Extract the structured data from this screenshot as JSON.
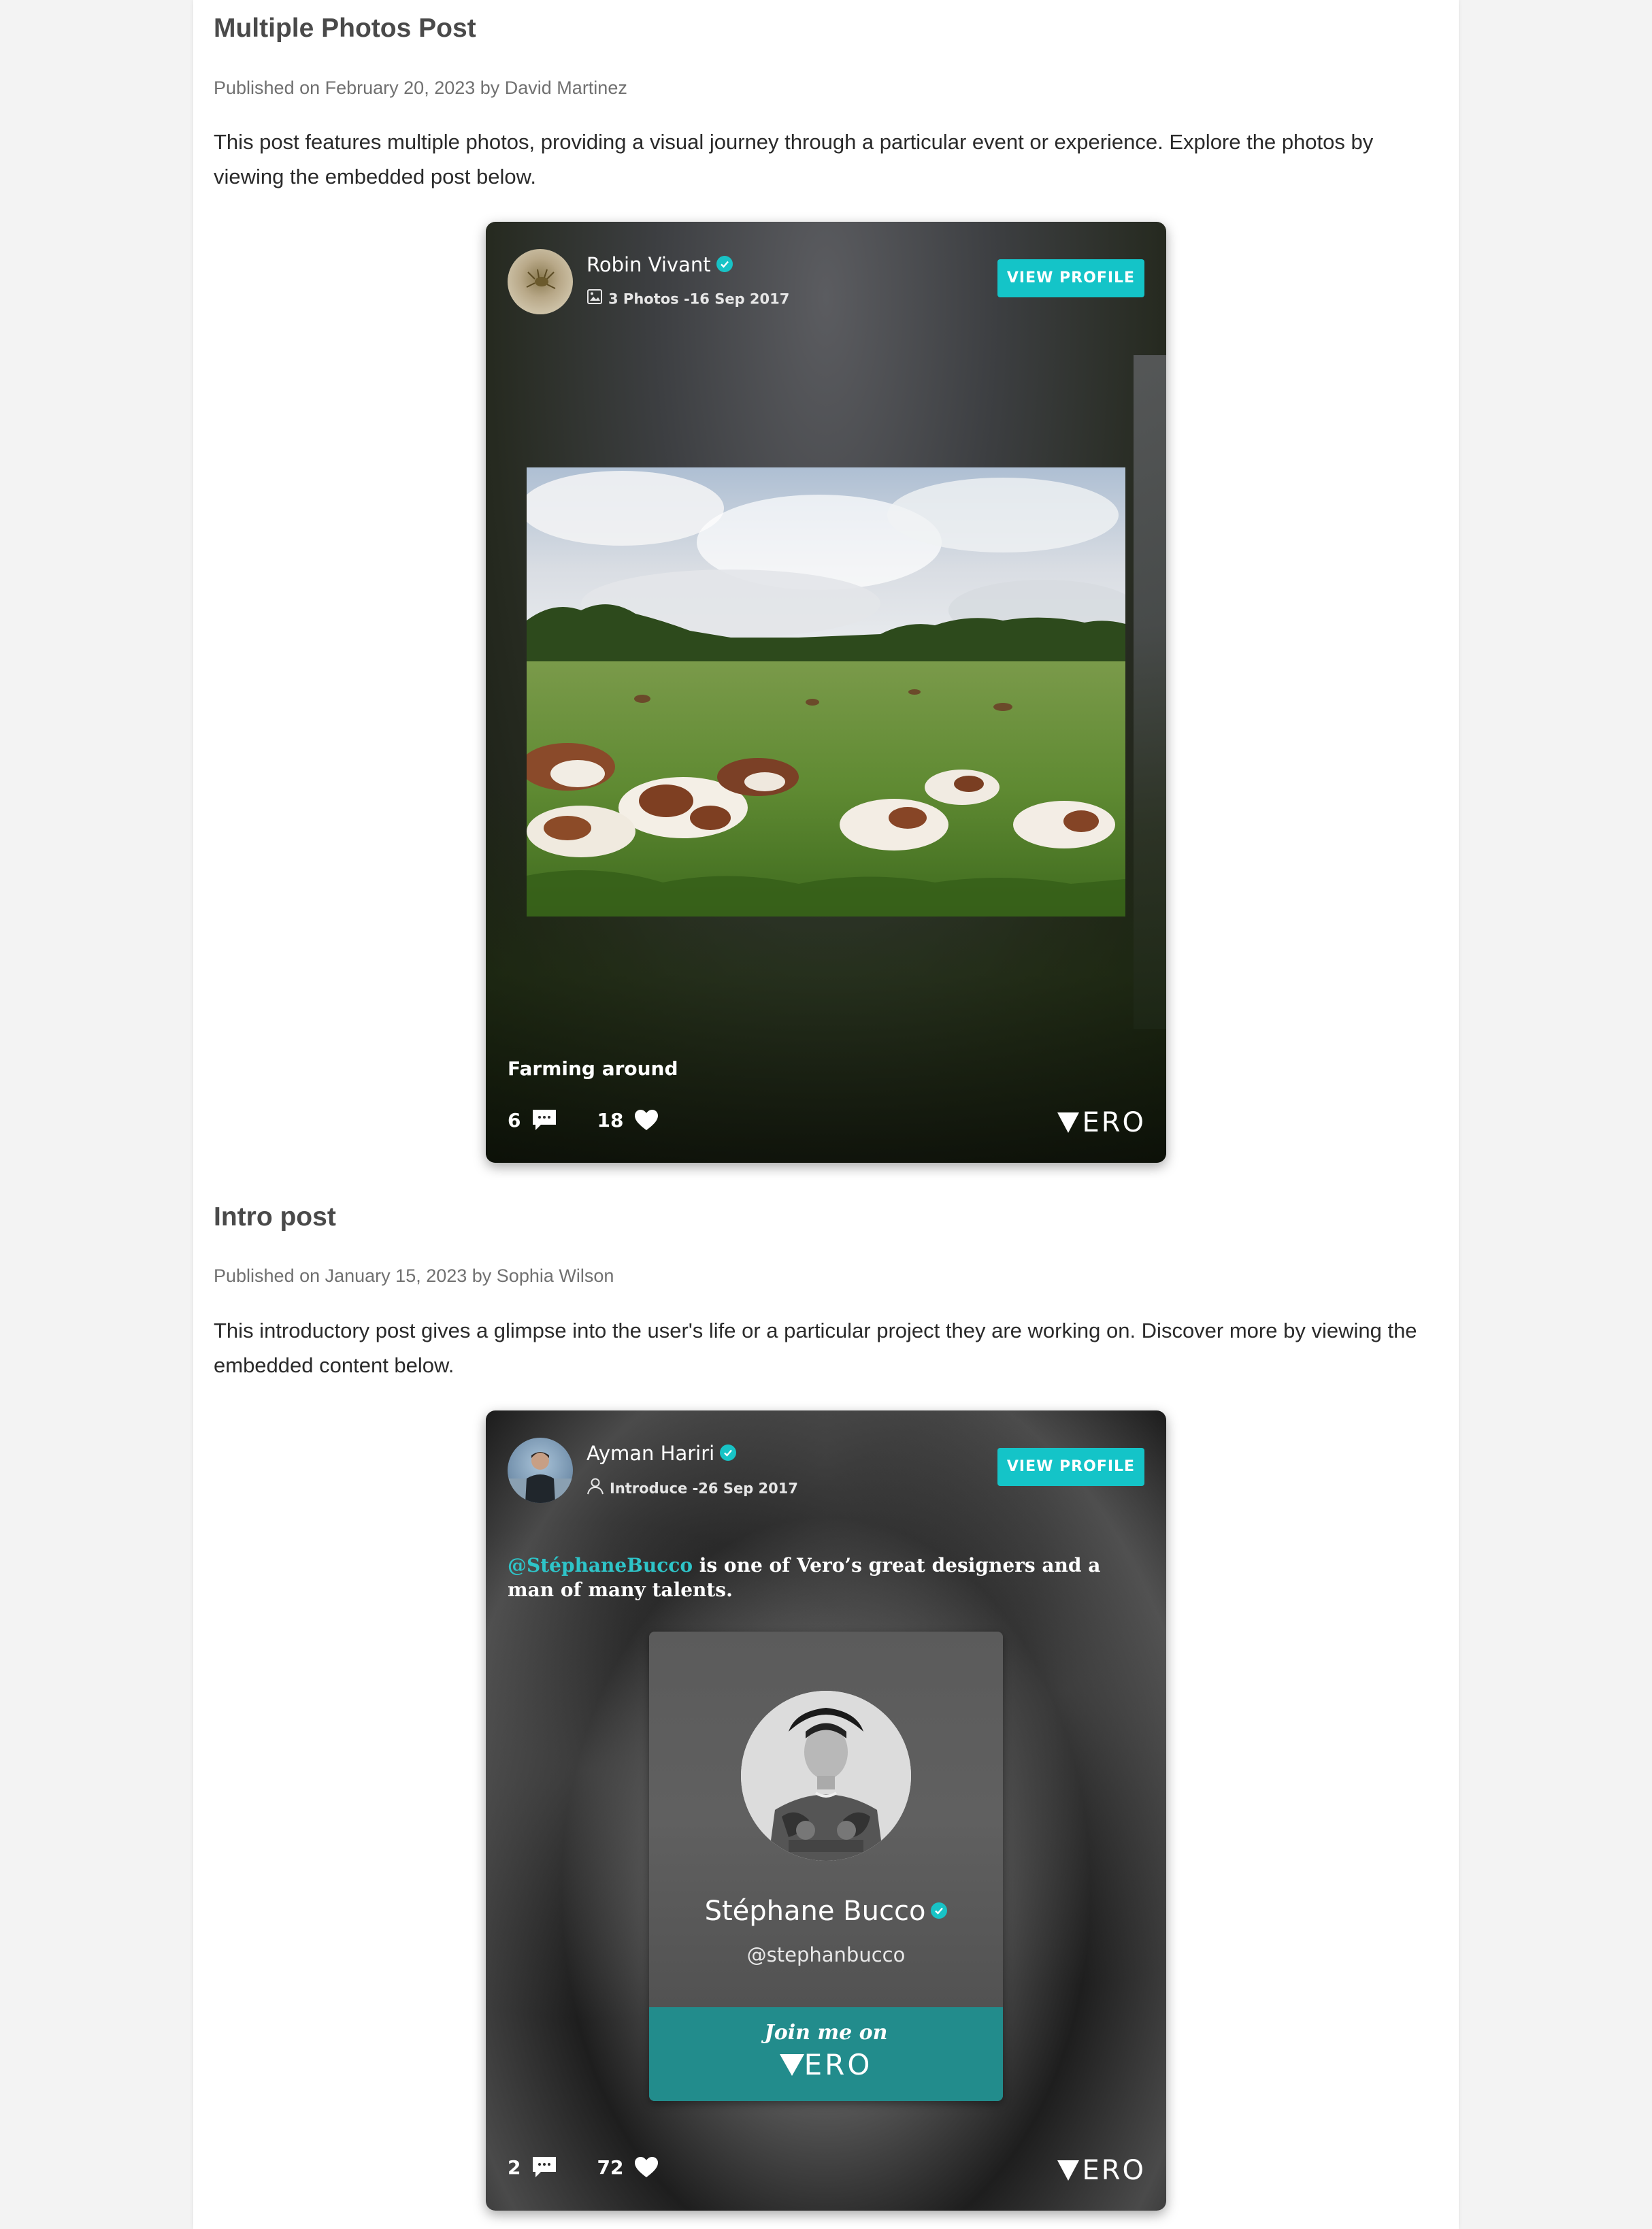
{
  "posts": [
    {
      "title": "Multiple Photos Post",
      "meta": "Published on February 20, 2023 by David Martinez",
      "body": "This post features multiple photos, providing a visual journey through a particular event or experience. Explore the photos by viewing the embedded post below.",
      "embed": {
        "author": "Robin Vivant",
        "subtitle": "3 Photos -16 Sep 2017",
        "subtitle_icon": "photo-icon",
        "view_profile": "VIEW PROFILE",
        "caption": "Farming around",
        "comments": "6",
        "likes": "18",
        "brand": "ERO"
      }
    },
    {
      "title": "Intro post",
      "meta": "Published on January 15, 2023 by Sophia Wilson",
      "body": "This introductory post gives a glimpse into the user's life or a particular project they are working on. Discover more by viewing the embedded content below.",
      "embed": {
        "author": "Ayman Hariri",
        "subtitle": "Introduce -26 Sep 2017",
        "subtitle_icon": "person-icon",
        "view_profile": "VIEW PROFILE",
        "mention": "@StéphaneBucco",
        "intro_text": " is one of Vero’s great designers and a man of many talents.",
        "card": {
          "name": "Stéphane Bucco",
          "handle": "@stephanbucco",
          "join_text": "Join me on",
          "join_brand": "ERO"
        },
        "comments": "2",
        "likes": "72",
        "brand": "ERO"
      }
    }
  ],
  "colors": {
    "accent": "#14c4c8",
    "join_bar": "#228c8c",
    "title": "#4a4a4a",
    "meta": "#707070"
  }
}
